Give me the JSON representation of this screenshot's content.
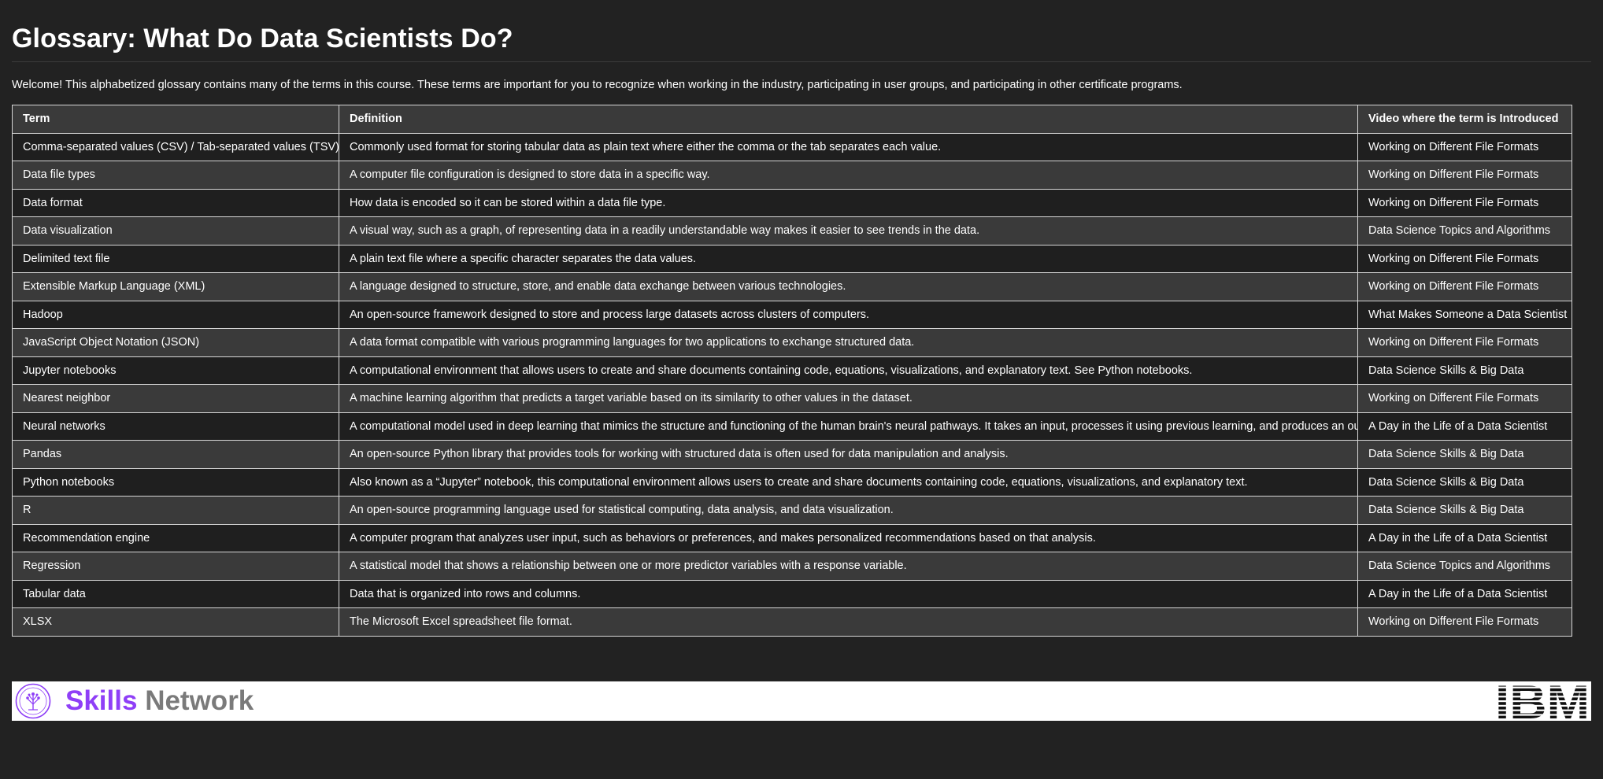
{
  "page": {
    "title": "Glossary: What Do Data Scientists Do?",
    "intro": "Welcome! This alphabetized glossary contains many of the terms in this course. These terms are important for you to recognize when working in the industry, participating in user groups, and participating in other certificate programs."
  },
  "table": {
    "headers": {
      "term": "Term",
      "definition": "Definition",
      "video": "Video where the term is Introduced"
    },
    "rows": [
      {
        "term": "Comma-separated values (CSV) / Tab-separated values (TSV)",
        "definition": "Commonly used format for storing tabular data as plain text where either the comma or the tab separates each value.",
        "video": "Working on Different File Formats"
      },
      {
        "term": "Data file types",
        "definition": "A computer file configuration is designed to store data in a specific way.",
        "video": "Working on Different File Formats"
      },
      {
        "term": "Data format",
        "definition": "How data is encoded so it can be stored within a data file type.",
        "video": "Working on Different File Formats"
      },
      {
        "term": "Data visualization",
        "definition": "A visual way, such as a graph, of representing data in a readily understandable way makes it easier to see trends in the data.",
        "video": "Data Science Topics and Algorithms"
      },
      {
        "term": "Delimited text file",
        "definition": "A plain text file where a specific character separates the data values.",
        "video": "Working on Different File Formats"
      },
      {
        "term": "Extensible Markup Language (XML)",
        "definition": "A language designed to structure, store, and enable data exchange between various technologies.",
        "video": "Working on Different File Formats"
      },
      {
        "term": "Hadoop",
        "definition": "An open-source framework designed to store and process large datasets across clusters of computers.",
        "video": "What Makes Someone a Data Scientist"
      },
      {
        "term": "JavaScript Object Notation (JSON)",
        "definition": "A data format compatible with various programming languages for two applications to exchange structured data.",
        "video": "Working on Different File Formats"
      },
      {
        "term": "Jupyter notebooks",
        "definition": "A computational environment that allows users to create and share documents containing code, equations, visualizations, and explanatory text. See Python notebooks.",
        "video": "Data Science Skills & Big Data"
      },
      {
        "term": "Nearest neighbor",
        "definition": "A machine learning algorithm that predicts a target variable based on its similarity to other values in the dataset.",
        "video": "Working on Different File Formats"
      },
      {
        "term": "Neural networks",
        "definition": "A computational model used in deep learning that mimics the structure and functioning of the human brain's neural pathways. It takes an input, processes it using previous learning, and produces an output.",
        "video": "A Day in the Life of a Data Scientist"
      },
      {
        "term": "Pandas",
        "definition": "An open-source Python library that provides tools for working with structured data is often used for data manipulation and analysis.",
        "video": "Data Science Skills & Big Data"
      },
      {
        "term": "Python notebooks",
        "definition": "Also known as a “Jupyter” notebook, this computational environment allows users to create and share documents containing code, equations, visualizations, and explanatory text.",
        "video": "Data Science Skills & Big Data"
      },
      {
        "term": "R",
        "definition": "An open-source programming language used for statistical computing, data analysis, and data visualization.",
        "video": "Data Science Skills & Big Data"
      },
      {
        "term": "Recommendation engine",
        "definition": "A computer program that analyzes user input, such as behaviors or preferences, and makes personalized recommendations based on that analysis.",
        "video": "A Day in the Life of a Data Scientist"
      },
      {
        "term": "Regression",
        "definition": "A statistical model that shows a relationship between one or more predictor variables with a response variable.",
        "video": "Data Science Topics and Algorithms"
      },
      {
        "term": "Tabular data",
        "definition": "Data that is organized into rows and columns.",
        "video": "A Day in the Life of a Data Scientist"
      },
      {
        "term": "XLSX",
        "definition": "The Microsoft Excel spreadsheet file format.",
        "video": "Working on Different File Formats"
      }
    ]
  },
  "footer": {
    "brand_primary": "Skills",
    "brand_secondary": "Network",
    "brand_primary_color": "#8f3ff7",
    "brand_secondary_color": "#7a7a7a",
    "brand_icon": "skills-network-tree-icon",
    "partner_logo": "ibm-logo",
    "partner_logo_text": "IBM"
  },
  "colors": {
    "background": "#222222",
    "row_dark": "#1f1f1f",
    "row_light": "#3a3a3a",
    "border": "#d6d6d6",
    "text": "#ffffff"
  }
}
